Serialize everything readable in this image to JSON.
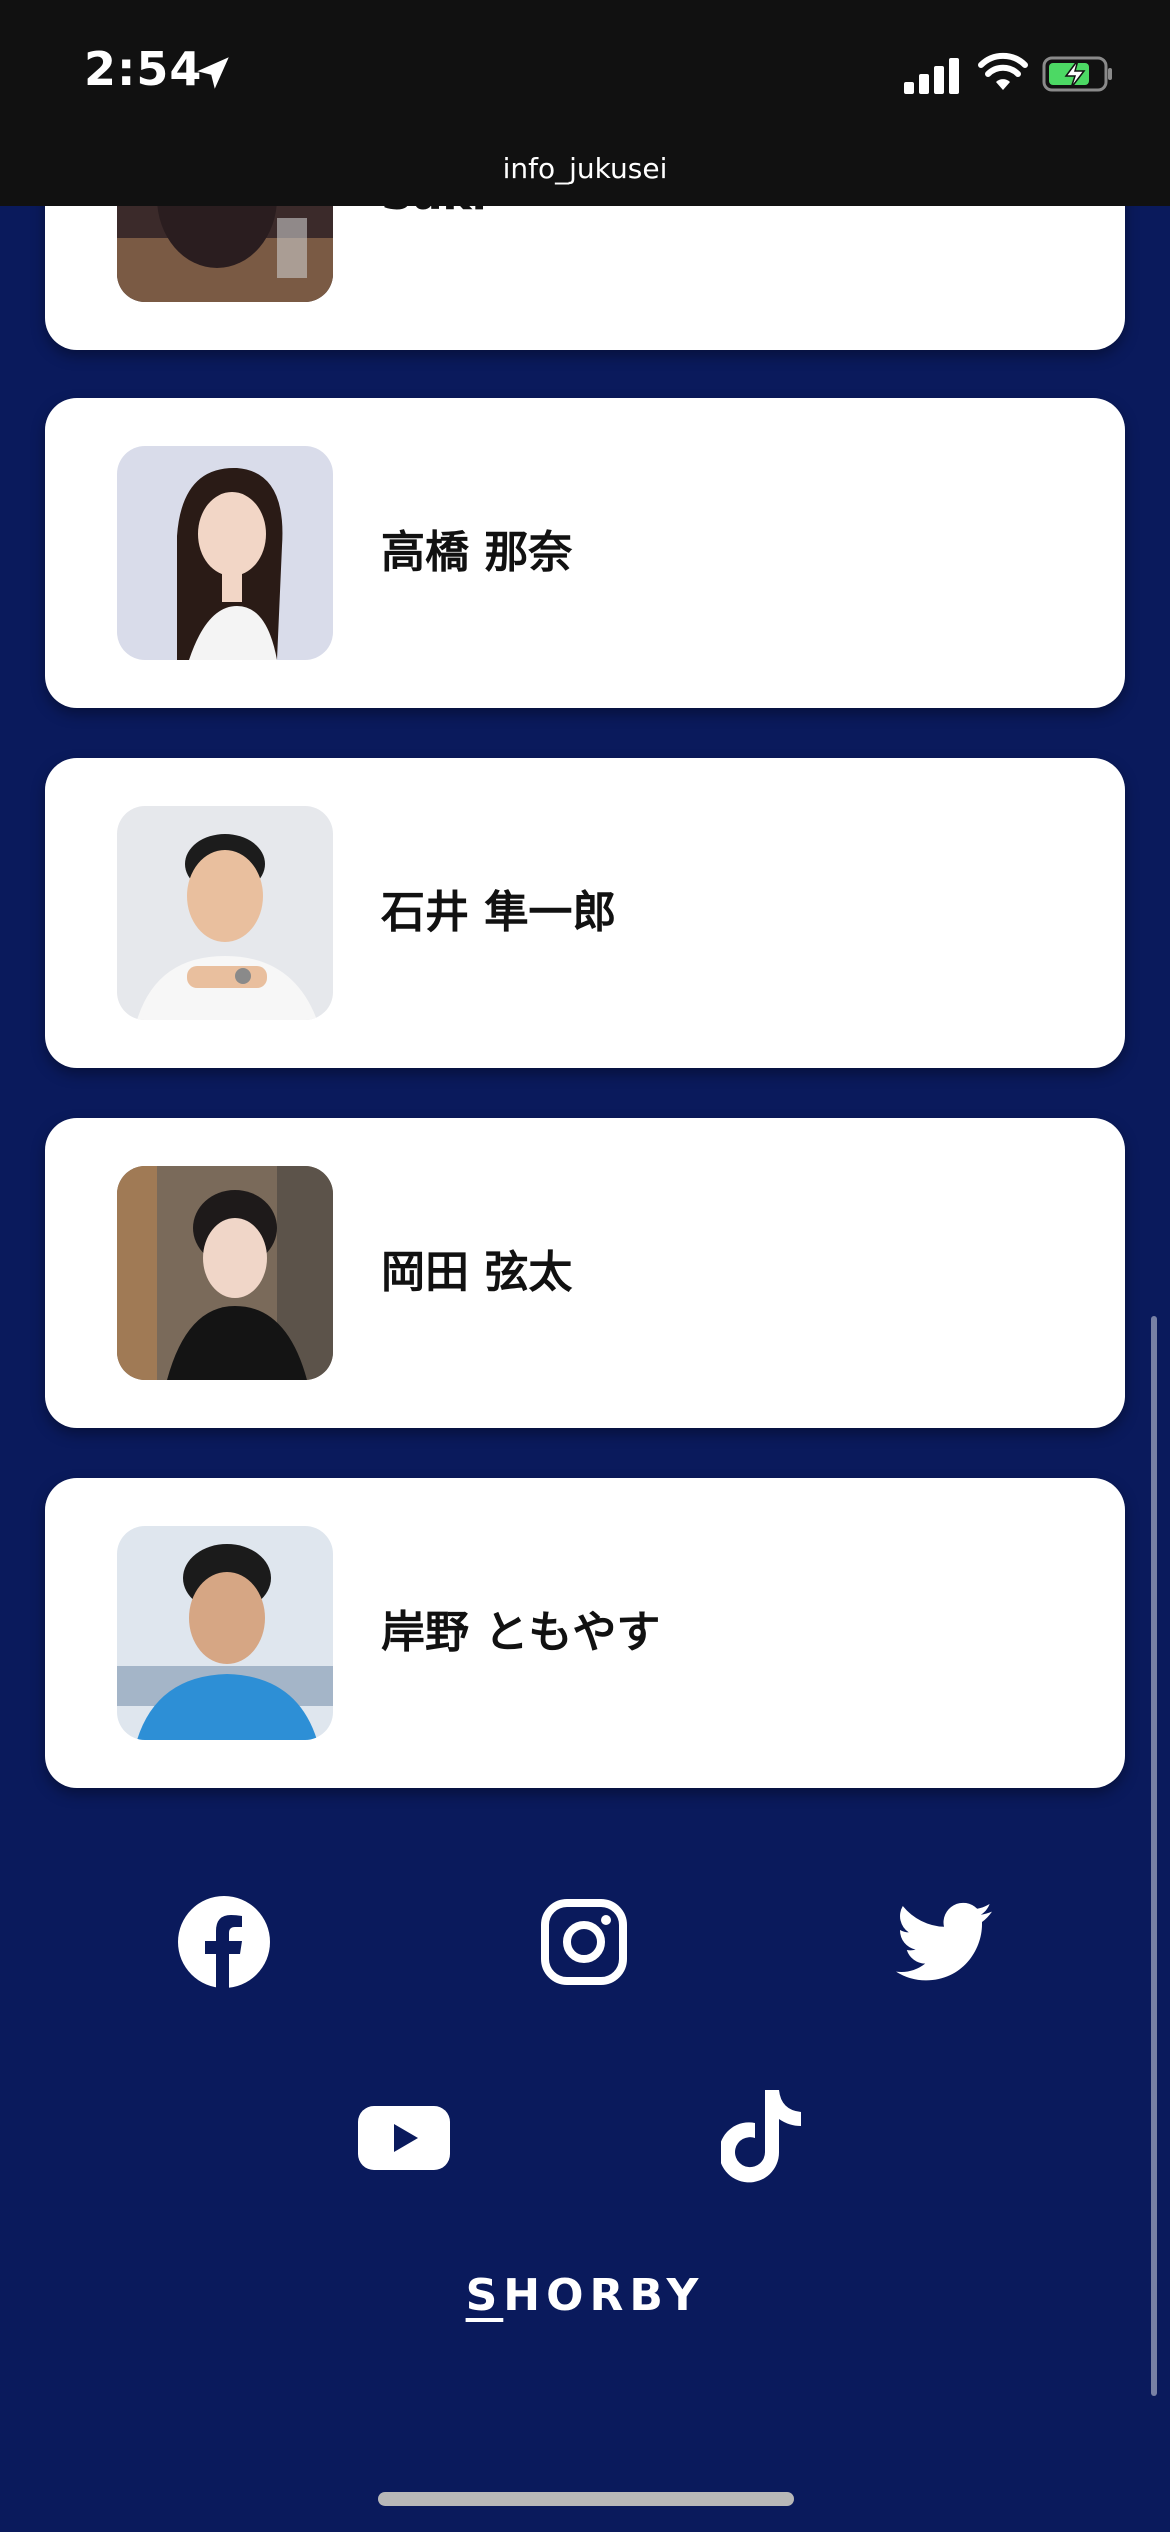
{
  "status_bar": {
    "time": "2:54",
    "url": "info_jukusei"
  },
  "cards": [
    {
      "name": "Saki"
    },
    {
      "name": "高橋 那奈"
    },
    {
      "name": "石井 隼一郎"
    },
    {
      "name": "岡田 弦太"
    },
    {
      "name": "岸野 ともやす"
    }
  ],
  "social_icons": [
    "facebook-icon",
    "instagram-icon",
    "twitter-icon",
    "youtube-icon",
    "tiktok-icon"
  ],
  "footer": {
    "brand_first": "S",
    "brand_rest": "HORBY"
  },
  "colors": {
    "background": "#0a1a5c",
    "card": "#ffffff",
    "status_bar": "#111111",
    "battery_fill": "#4cd964"
  }
}
